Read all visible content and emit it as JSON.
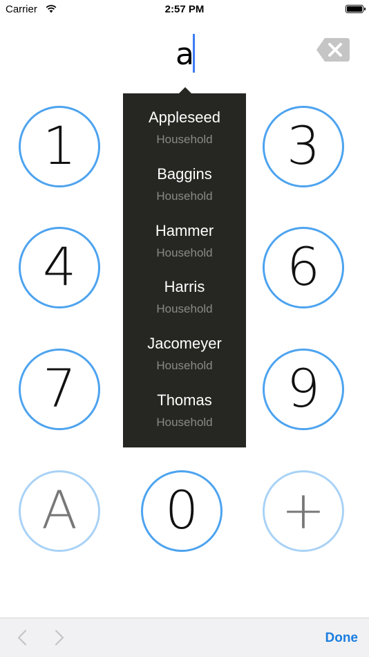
{
  "status_bar": {
    "carrier": "Carrier",
    "time": "2:57 PM"
  },
  "entry": {
    "text": "a"
  },
  "keypad": {
    "keys": [
      {
        "label": "1",
        "style": "normal"
      },
      {
        "label": "3",
        "style": "normal"
      },
      {
        "label": "4",
        "style": "normal"
      },
      {
        "label": "6",
        "style": "normal"
      },
      {
        "label": "7",
        "style": "normal"
      },
      {
        "label": "9",
        "style": "normal"
      },
      {
        "label": "A",
        "style": "light"
      },
      {
        "label": "0",
        "style": "normal"
      },
      {
        "label": "+",
        "style": "light"
      }
    ]
  },
  "suggestions": [
    {
      "name": "Appleseed",
      "subtitle": "Household"
    },
    {
      "name": "Baggins",
      "subtitle": "Household"
    },
    {
      "name": "Hammer",
      "subtitle": "Household"
    },
    {
      "name": "Harris",
      "subtitle": "Household"
    },
    {
      "name": "Jacomeyer",
      "subtitle": "Household"
    },
    {
      "name": "Thomas",
      "subtitle": "Household"
    }
  ],
  "toolbar": {
    "done_label": "Done"
  },
  "colors": {
    "accent": "#4da3ef",
    "accent_light": "#a9d2f6",
    "popover_bg": "#262622",
    "done": "#1a7de0"
  },
  "icons": {
    "backspace": "backspace-icon",
    "wifi": "wifi-icon",
    "prev": "chevron-left-icon",
    "next": "chevron-right-icon"
  }
}
